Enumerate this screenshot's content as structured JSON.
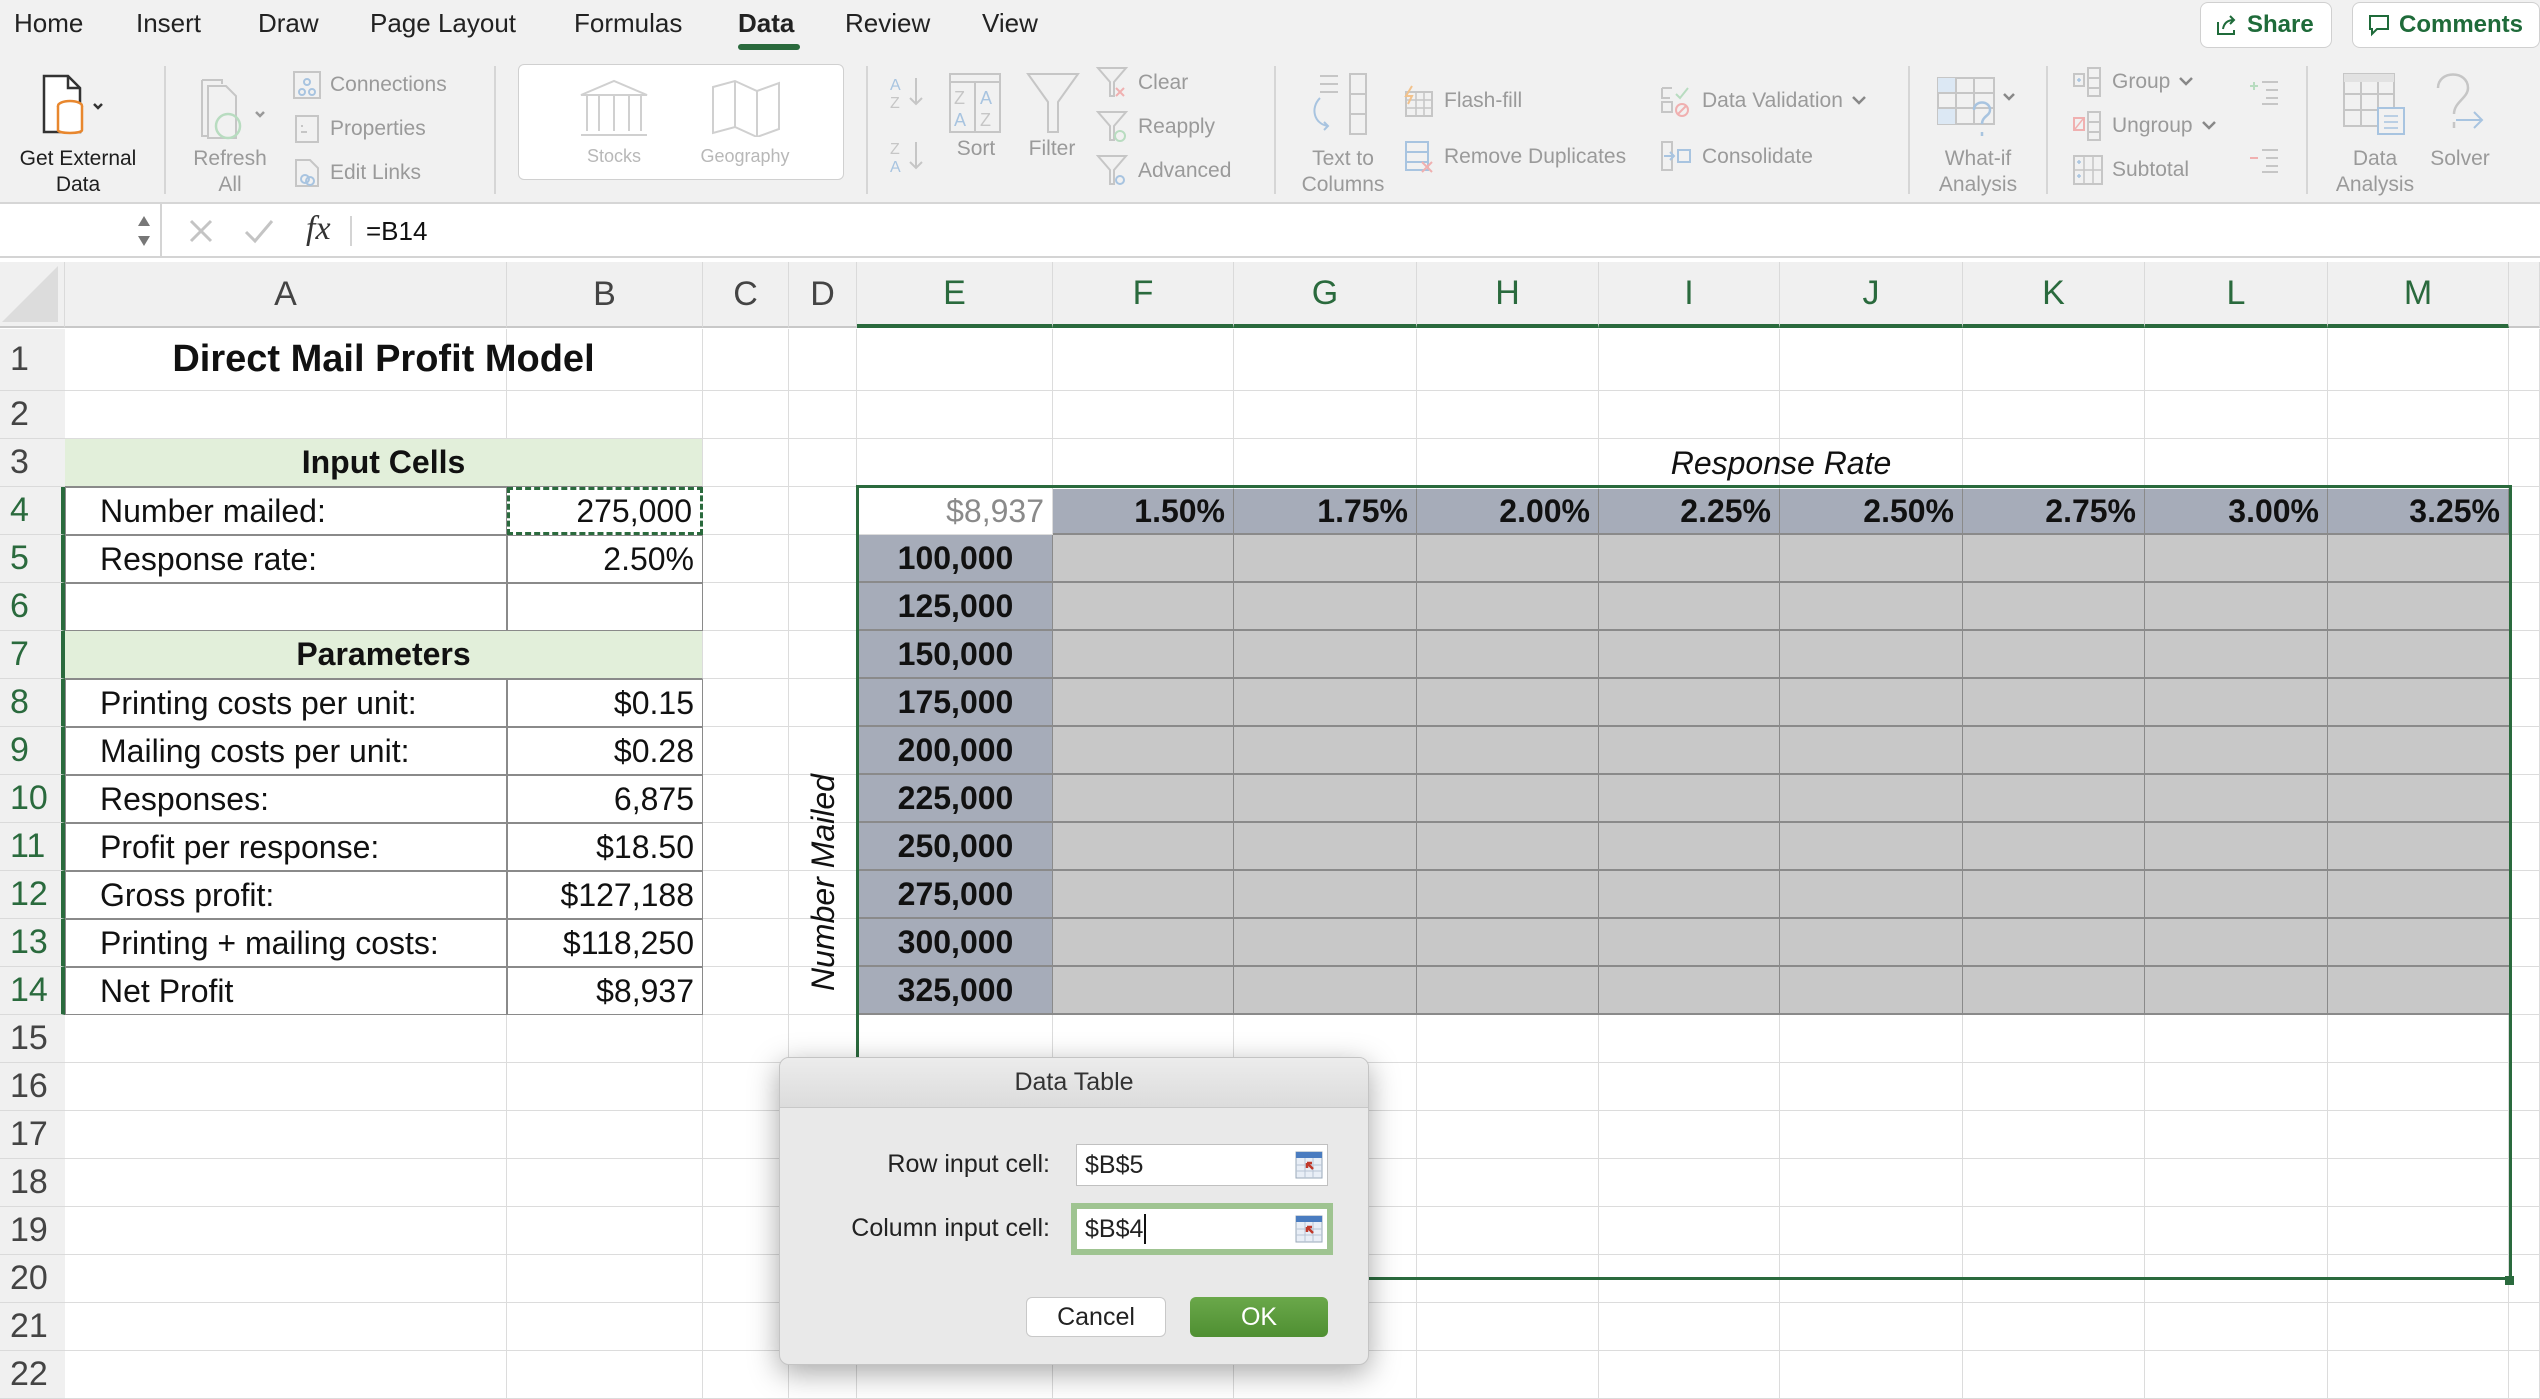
{
  "menu": {
    "tabs": [
      "Home",
      "Insert",
      "Draw",
      "Page Layout",
      "Formulas",
      "Data",
      "Review",
      "View"
    ],
    "active_tab": "Data",
    "share_label": "Share",
    "comments_label": "Comments"
  },
  "ribbon": {
    "get_external_data": "Get External Data",
    "get_external_data_l1": "Get External",
    "get_external_data_l2": "Data",
    "refresh_l1": "Refresh",
    "refresh_l2": "All",
    "connections": "Connections",
    "properties": "Properties",
    "edit_links": "Edit Links",
    "stocks": "Stocks",
    "geography": "Geography",
    "sort": "Sort",
    "filter": "Filter",
    "clear": "Clear",
    "reapply": "Reapply",
    "advanced": "Advanced",
    "text_to_columns_l1": "Text to",
    "text_to_columns_l2": "Columns",
    "flash_fill": "Flash-fill",
    "remove_duplicates": "Remove Duplicates",
    "data_validation": "Data Validation",
    "consolidate": "Consolidate",
    "what_if_l1": "What-if",
    "what_if_l2": "Analysis",
    "group": "Group",
    "ungroup": "Ungroup",
    "subtotal": "Subtotal",
    "data_analysis_l1": "Data",
    "data_analysis_l2": "Analysis",
    "solver": "Solver"
  },
  "formula_bar": {
    "name_box": "",
    "fx_label": "fx",
    "formula": "=B14"
  },
  "sheet": {
    "columns": [
      "A",
      "B",
      "C",
      "D",
      "E",
      "F",
      "G",
      "H",
      "I",
      "J",
      "K",
      "L",
      "M"
    ],
    "rows": [
      "1",
      "2",
      "3",
      "4",
      "5",
      "6",
      "7",
      "8",
      "9",
      "10",
      "11",
      "12",
      "13",
      "14",
      "15",
      "16",
      "17",
      "18",
      "19",
      "20",
      "21",
      "22"
    ],
    "title": "Direct Mail Profit Model",
    "input_header": "Input Cells",
    "inputs": [
      {
        "label": "Number mailed:",
        "value": "275,000"
      },
      {
        "label": "Response rate:",
        "value": "2.50%"
      }
    ],
    "params_header": "Parameters",
    "params": [
      {
        "label": "Printing costs per unit:",
        "value": "$0.15"
      },
      {
        "label": "Mailing costs per unit:",
        "value": "$0.28"
      },
      {
        "label": "Responses:",
        "value": "6,875"
      },
      {
        "label": "Profit per response:",
        "value": "$18.50"
      },
      {
        "label": "Gross profit:",
        "value": "$127,188"
      },
      {
        "label": "Printing + mailing costs:",
        "value": "$118,250"
      },
      {
        "label": "Net Profit",
        "value": "$8,937"
      }
    ],
    "data_table": {
      "row_axis_label": "Response Rate",
      "col_axis_label": "Number Mailed",
      "corner_value": "$8,937",
      "rates": [
        "1.50%",
        "1.75%",
        "2.00%",
        "2.25%",
        "2.50%",
        "2.75%",
        "3.00%",
        "3.25%"
      ],
      "mailed": [
        "100,000",
        "125,000",
        "150,000",
        "175,000",
        "200,000",
        "225,000",
        "250,000",
        "275,000",
        "300,000",
        "325,000"
      ]
    }
  },
  "dialog": {
    "title": "Data Table",
    "row_input_label": "Row input cell:",
    "row_input_value": "$B$5",
    "col_input_label": "Column input cell:",
    "col_input_value": "$B$4",
    "cancel_label": "Cancel",
    "ok_label": "OK"
  },
  "colors": {
    "accent": "#2a6a3d",
    "header_fill": "#e2efda",
    "table_header_fill": "#a6acb9",
    "table_body_fill": "#c8c8c8",
    "ok_button": "#5a9a3c"
  }
}
